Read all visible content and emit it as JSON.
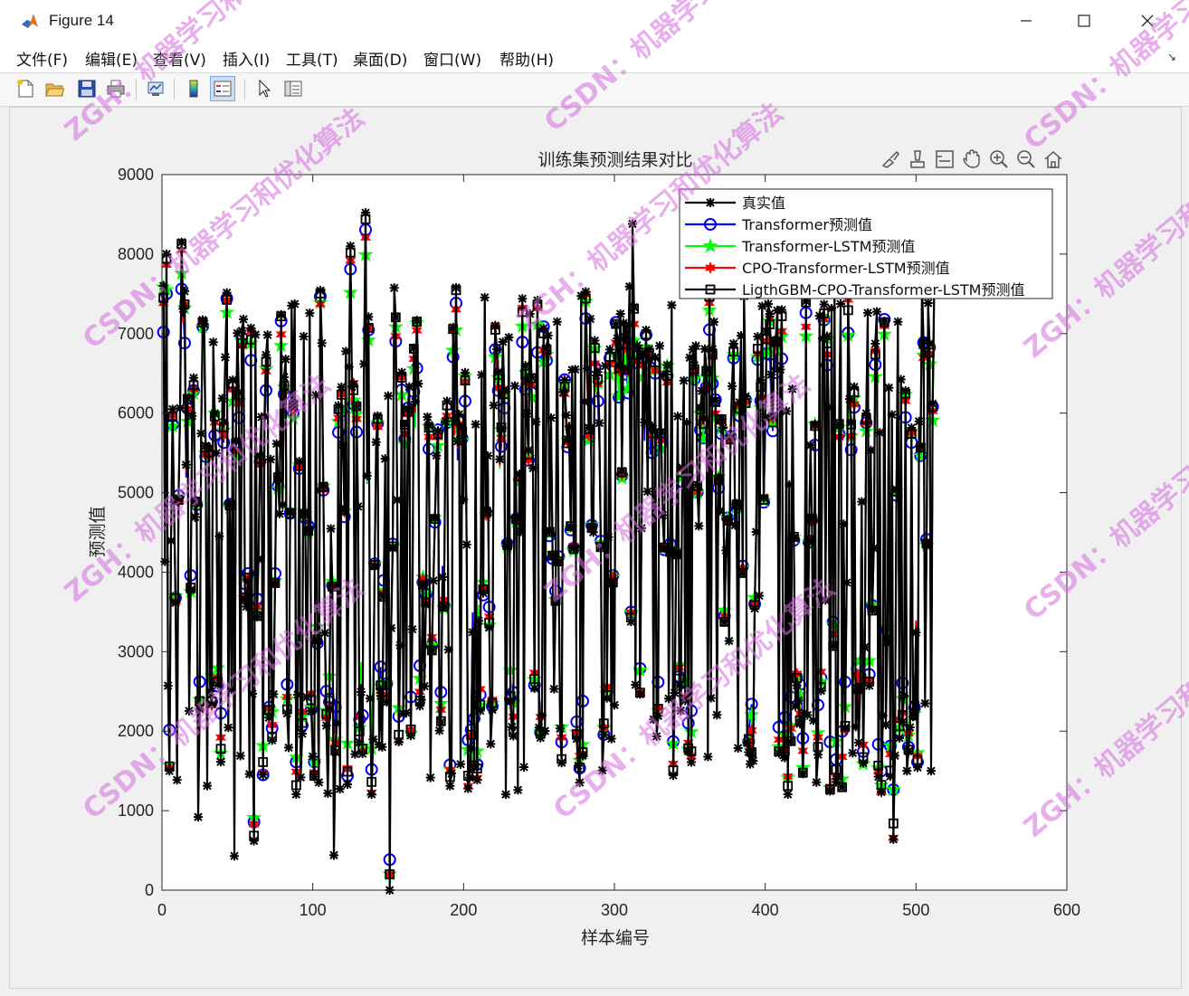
{
  "window": {
    "title": "Figure 14"
  },
  "menu": [
    {
      "label": "文件(F)"
    },
    {
      "label": "编辑(E)"
    },
    {
      "label": "查看(V)"
    },
    {
      "label": "插入(I)"
    },
    {
      "label": "工具(T)"
    },
    {
      "label": "桌面(D)"
    },
    {
      "label": "窗口(W)"
    },
    {
      "label": "帮助(H)"
    }
  ],
  "toolbar": [
    "new-figure",
    "open-file",
    "save",
    "print",
    "link-plot",
    "colorbar",
    "legend",
    "edit-plot",
    "property-inspector"
  ],
  "axes_toolbar": [
    "brush",
    "data-tips",
    "legend-toggle",
    "pan",
    "zoom-in",
    "zoom-out",
    "restore-view"
  ],
  "watermarks": [
    "ZGH：机器学习和优化算法",
    "CSDN：机器学习和优化算法"
  ],
  "chart_data": {
    "type": "line",
    "title": "训练集预测结果对比",
    "xlabel": "样本编号",
    "ylabel": "预测值",
    "xlim": [
      0,
      600
    ],
    "ylim": [
      0,
      9000
    ],
    "xticks": [
      "0",
      "100",
      "200",
      "300",
      "400",
      "500",
      "600"
    ],
    "yticks": [
      "0",
      "1000",
      "2000",
      "3000",
      "4000",
      "5000",
      "6000",
      "7000",
      "8000",
      "9000"
    ],
    "grid": false,
    "legend_position": "top-right",
    "n_points": 512,
    "note": "512 samples per series; values approximated (dense overlapping plot). Series 1 is the true value; other series track it closely with small deviations.",
    "anchor_points": [
      {
        "x": 1,
        "y": 7600
      },
      {
        "x": 3,
        "y": 8000
      },
      {
        "x": 5,
        "y": 1500
      },
      {
        "x": 13,
        "y": 8150
      },
      {
        "x": 24,
        "y": 920
      },
      {
        "x": 48,
        "y": 430
      },
      {
        "x": 61,
        "y": 620
      },
      {
        "x": 114,
        "y": 440
      },
      {
        "x": 125,
        "y": 8100
      },
      {
        "x": 135,
        "y": 8520
      },
      {
        "x": 151,
        "y": 0
      },
      {
        "x": 312,
        "y": 8380
      },
      {
        "x": 485,
        "y": 640
      },
      {
        "x": 510,
        "y": 1500
      }
    ],
    "series": [
      {
        "name": "真实值",
        "color": "#000000",
        "marker": "asterisk"
      },
      {
        "name": "Transformer预测值",
        "color": "#0000ff",
        "marker": "circle"
      },
      {
        "name": "Transformer-LSTM预测值",
        "color": "#00ff00",
        "marker": "pentagram"
      },
      {
        "name": "CPO-Transformer-LSTM预测值",
        "color": "#ff0000",
        "marker": "hexagram"
      },
      {
        "name": "LigthGBM-CPO-Transformer-LSTM预测值",
        "color": "#000000",
        "marker": "square"
      }
    ]
  }
}
